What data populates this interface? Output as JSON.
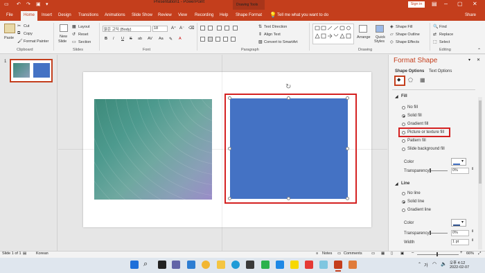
{
  "title_bar": {
    "document": "Presentation1 - PowerPoint",
    "contextual": "Drawing Tools",
    "sign_in": "Sign in",
    "colors": {
      "accent": "#c43e1c"
    }
  },
  "tabs": [
    "File",
    "Home",
    "Insert",
    "Design",
    "Transitions",
    "Animations",
    "Slide Show",
    "Review",
    "View",
    "Recording",
    "Help",
    "Shape Format"
  ],
  "active_tab": "Home",
  "tell_me": "Tell me what you want to do",
  "share": "Share",
  "ribbon": {
    "clipboard": {
      "paste": "Paste",
      "cut": "Cut",
      "copy": "Copy",
      "format_painter": "Format Painter",
      "label": "Clipboard"
    },
    "slides": {
      "new_slide": "New",
      "new_slide2": "Slide",
      "layout": "Layout",
      "reset": "Reset",
      "section": "Section",
      "label": "Slides"
    },
    "font": {
      "name": "맑은 고딕 (Body)",
      "size": "18",
      "bold": "B",
      "italic": "I",
      "underline": "U",
      "strike": "S",
      "shadow": "ab",
      "spacing": "AV",
      "case": "Aa",
      "color": "A",
      "label": "Font"
    },
    "paragraph": {
      "text_direction": "Text Direction",
      "align_text": "Align Text",
      "smartart": "Convert to SmartArt",
      "label": "Paragraph"
    },
    "drawing": {
      "arrange": "Arrange",
      "quick_styles": "Quick",
      "quick_styles2": "Styles",
      "shape_fill": "Shape Fill",
      "shape_outline": "Shape Outline",
      "shape_effects": "Shape Effects",
      "label": "Drawing"
    },
    "editing": {
      "find": "Find",
      "replace": "Replace",
      "select": "Select",
      "label": "Editing"
    }
  },
  "thumbnail_number": "1",
  "format_pane": {
    "title": "Format Shape",
    "tabs": [
      "Shape Options",
      "Text Options"
    ],
    "fill_header": "Fill",
    "fill_options": [
      "No fill",
      "Solid fill",
      "Gradient fill",
      "Picture or texture fill",
      "Pattern fill",
      "Slide background fill"
    ],
    "fill_selected": "Solid fill",
    "color_label": "Color",
    "transparency_label": "Transparency",
    "transparency_value": "0%",
    "line_header": "Line",
    "line_options": [
      "No line",
      "Solid line",
      "Gradient line"
    ],
    "line_selected": "Solid line",
    "line_color_label": "Color",
    "line_transparency_label": "Transparency",
    "line_transparency_value": "0%",
    "width_label": "Width",
    "width_value": "1 pt"
  },
  "status": {
    "slide_info": "Slide 1 of 1",
    "language": "Korean",
    "notes": "Notes",
    "comments": "Comments",
    "zoom": "66%"
  },
  "taskbar": {
    "time": "오후 4:12",
    "date": "2022-02-07",
    "ime": "가"
  },
  "shape_colors": {
    "blue": "#4472c4",
    "selection": "#d42020"
  }
}
